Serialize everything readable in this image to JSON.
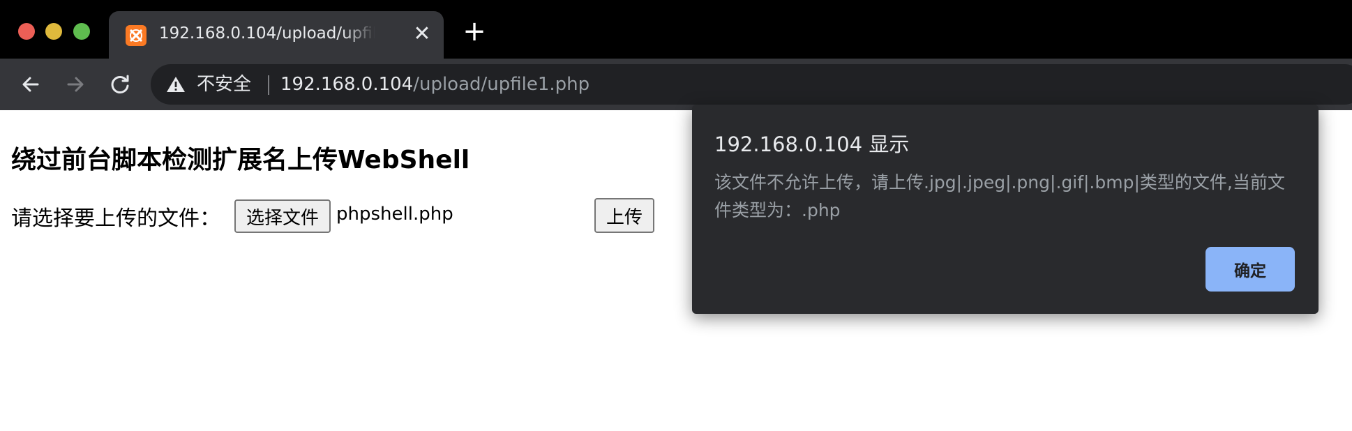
{
  "window": {
    "traffic_lights": [
      "close",
      "minimize",
      "maximize"
    ]
  },
  "tab": {
    "favicon": "xampp-icon",
    "title": "192.168.0.104/upload/upfile1.php",
    "close_glyph": "✕"
  },
  "new_tab_glyph": "+",
  "omnibox": {
    "security_label": "不安全",
    "url_host": "192.168.0.104",
    "url_path": "/upload/upfile1.php"
  },
  "page": {
    "heading": "绕过前台脚本检测扩展名上传WebShell",
    "upload_label": "请选择要上传的文件：",
    "choose_file_button": "选择文件",
    "selected_file": "phpshell.php",
    "submit_button": "上传"
  },
  "dialog": {
    "title": "192.168.0.104 显示",
    "message": "该文件不允许上传，请上传.jpg|.jpeg|.png|.gif|.bmp|类型的文件,当前文件类型为：.php",
    "ok_button": "确定"
  },
  "colors": {
    "tabbar_bg": "#000000",
    "toolbar_bg": "#35363a",
    "omnibox_bg": "#202124",
    "dialog_bg": "#292a2d",
    "dialog_button": "#8ab4f8",
    "close_light": "#ec5f56",
    "min_light": "#dfb93c",
    "max_light": "#5fbd4f"
  }
}
